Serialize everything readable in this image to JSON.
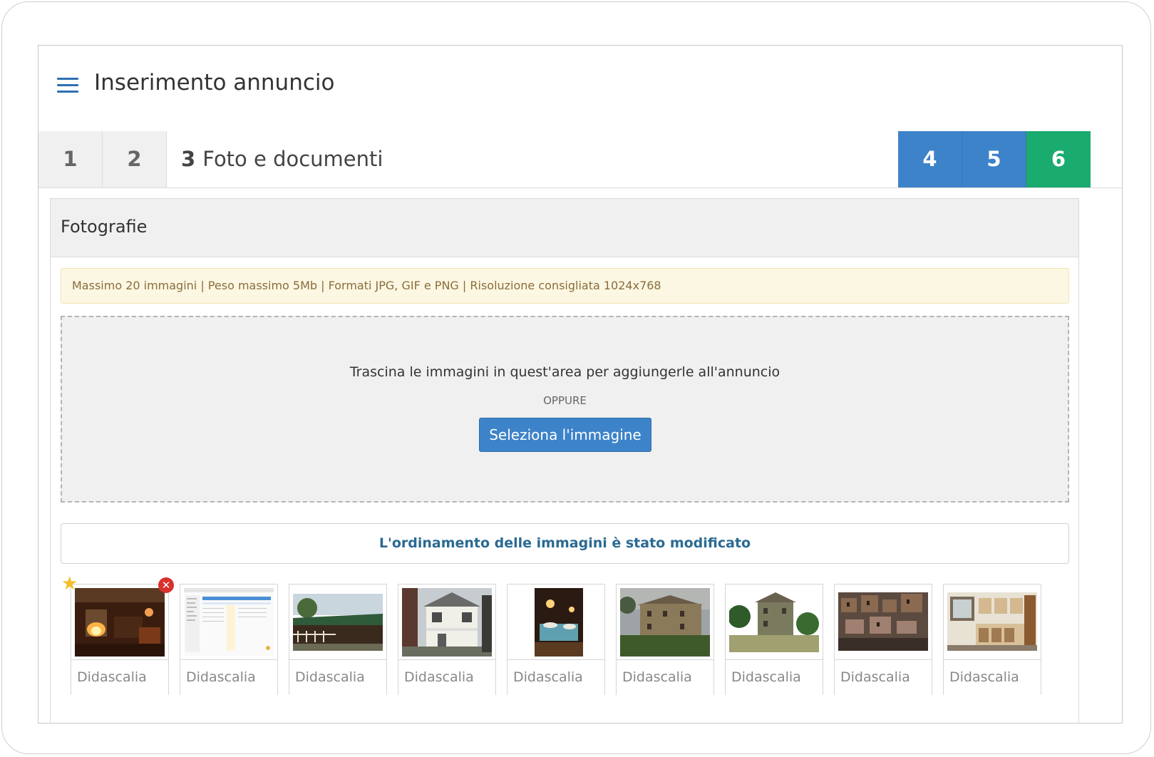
{
  "header": {
    "title": "Inserimento annuncio",
    "menu_icon": "hamburger-menu-icon"
  },
  "steps": [
    {
      "number": "1",
      "state": "done"
    },
    {
      "number": "2",
      "state": "done"
    },
    {
      "number": "3",
      "label": "Foto e documenti",
      "state": "active"
    },
    {
      "number": "4",
      "state": "todo"
    },
    {
      "number": "5",
      "state": "todo"
    },
    {
      "number": "6",
      "state": "final"
    }
  ],
  "colors": {
    "step_blue": "#3d83c9",
    "step_green": "#1aab6f",
    "alert_text": "#8a6d3b",
    "sort_message": "#2a6a93",
    "remove_badge": "#d9312b",
    "star": "#f2c028"
  },
  "panel": {
    "title": "Fotografie",
    "alert": "Massimo 20 immagini | Peso massimo 5Mb | Formati JPG, GIF e PNG | Risoluzione consigliata 1024x768",
    "dropzone": {
      "text": "Trascina le immagini in quest'area per aggiungerle all'annuncio",
      "or": "OPPURE",
      "button": "Seleziona l'immagine"
    },
    "sort_message": "L'ordinamento delle immagini è stato modificato",
    "photos": [
      {
        "caption": "Didascalia",
        "kind": "interior-fireplace",
        "primary": true,
        "removable": true
      },
      {
        "caption": "Didascalia",
        "kind": "screenshot"
      },
      {
        "caption": "Didascalia",
        "kind": "barn"
      },
      {
        "caption": "Didascalia",
        "kind": "house"
      },
      {
        "caption": "Didascalia",
        "kind": "restaurant"
      },
      {
        "caption": "Didascalia",
        "kind": "stone-farmhouse"
      },
      {
        "caption": "Didascalia",
        "kind": "villa-trees"
      },
      {
        "caption": "Didascalia",
        "kind": "old-town"
      },
      {
        "caption": "Didascalia",
        "kind": "kitchen"
      }
    ]
  }
}
